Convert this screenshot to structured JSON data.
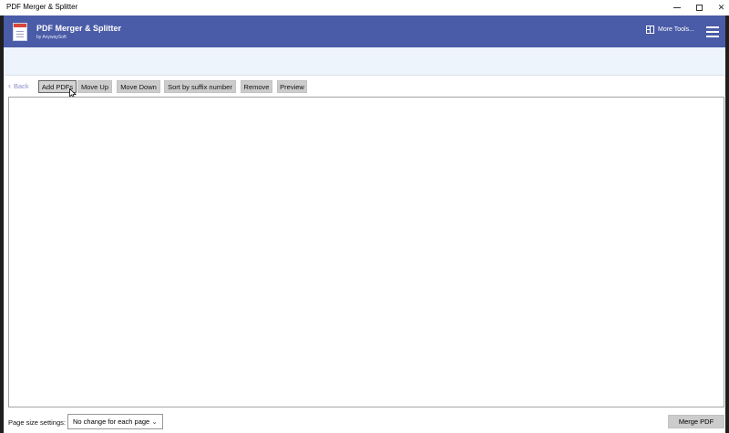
{
  "window": {
    "title": "PDF Merger & Splitter",
    "minimize": "—",
    "maximize": "☐",
    "close": "✕"
  },
  "header": {
    "app_name": "PDF Merger & Splitter",
    "by_line": "by AnywaySoft",
    "more_tools_label": "More Tools...",
    "accent_color": "#4a5ba7"
  },
  "toolbar": {
    "back_label": "Back",
    "buttons": [
      {
        "label": "Add PDFs"
      },
      {
        "label": "Move Up"
      },
      {
        "label": "Move Down"
      },
      {
        "label": "Sort by suffix number"
      },
      {
        "label": "Remove"
      },
      {
        "label": "Preview"
      }
    ]
  },
  "file_list": {
    "items": []
  },
  "footer": {
    "page_size_label": "Page size settings:",
    "page_size_value": "No change for each page",
    "merge_label": "Merge PDF"
  }
}
